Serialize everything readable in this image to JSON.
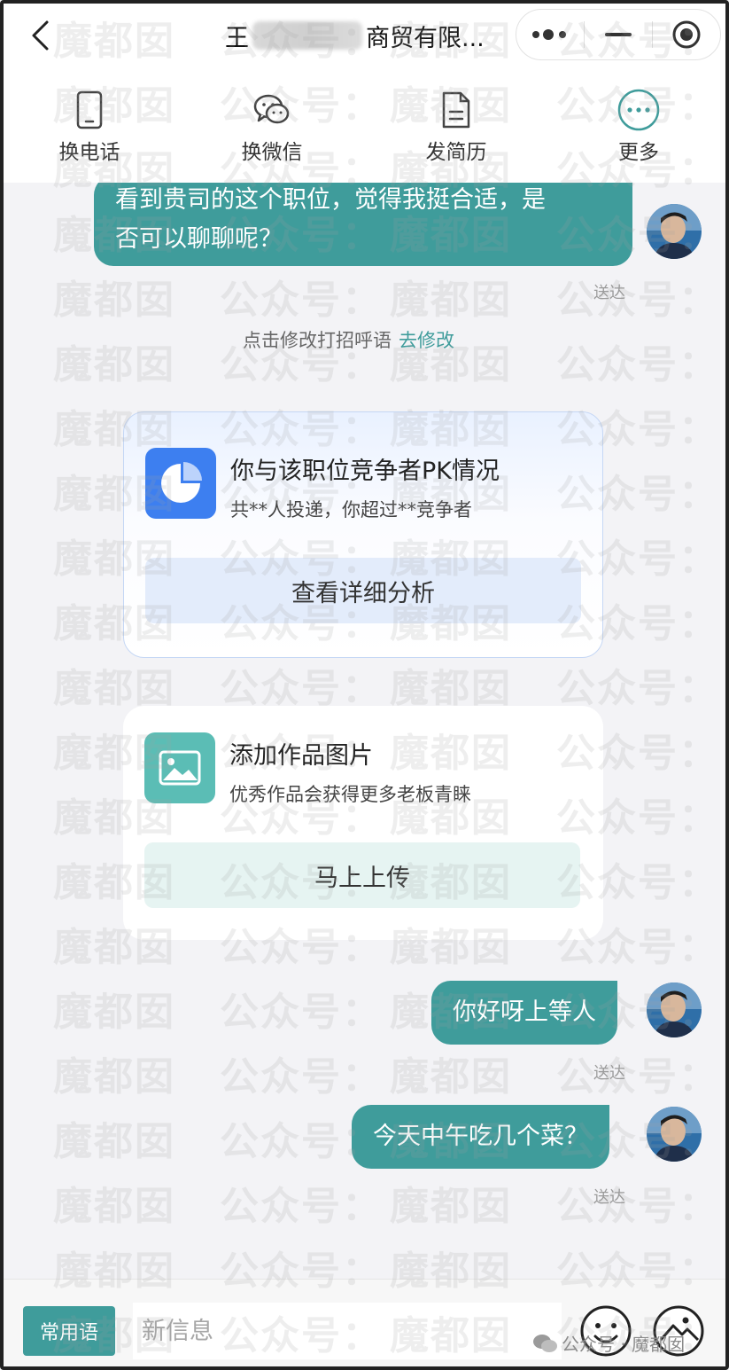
{
  "header": {
    "title_prefix": "王",
    "title_suffix": "商贸有限...",
    "capsule": {
      "more_icon": "dots-icon",
      "minimize_icon": "minus-icon",
      "close_icon": "target-icon"
    }
  },
  "toolbar": {
    "items": [
      {
        "label": "换电话",
        "icon": "phone-icon"
      },
      {
        "label": "换微信",
        "icon": "wechat-icon"
      },
      {
        "label": "发简历",
        "icon": "document-icon"
      },
      {
        "label": "更多",
        "icon": "more-icon"
      }
    ]
  },
  "messages": {
    "first": {
      "text_line1": "看到贵司的这个职位，觉得我挺合适，是",
      "text_line2": "否可以聊聊呢？",
      "status": "送达"
    },
    "second": {
      "text": "你好呀上等人",
      "status": "送达"
    },
    "third": {
      "text": "今天中午吃几个菜？",
      "status": "送达"
    }
  },
  "system": {
    "text": "点击修改打招呼语",
    "link": "去修改"
  },
  "pk_card": {
    "title": "你与该职位竞争者PK情况",
    "subtitle": "共**人投递，你超过**竞争者",
    "button": "查看详细分析"
  },
  "upload_card": {
    "title": "添加作品图片",
    "subtitle": "优秀作品会获得更多老板青睐",
    "button": "马上上传"
  },
  "input_bar": {
    "phrase_button": "常用语",
    "placeholder": "新信息"
  },
  "credit": {
    "text": "公众号 · 魔都囡"
  },
  "watermark": {
    "text_a": "魔都囡",
    "text_b": "公众号："
  },
  "colors": {
    "accent": "#3f9c9b",
    "pk_icon": "#3d7ff0",
    "upload_icon": "#5bbdb5"
  }
}
